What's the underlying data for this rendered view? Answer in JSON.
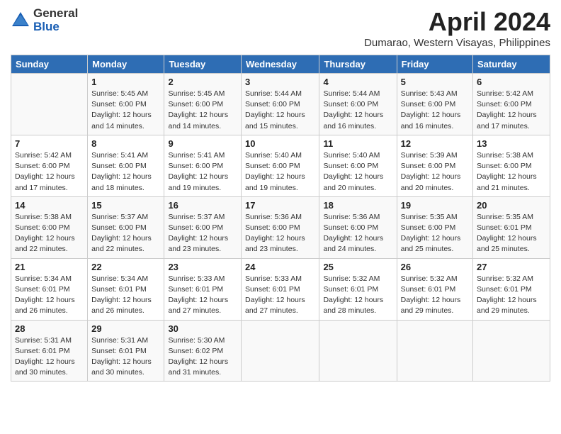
{
  "logo": {
    "general": "General",
    "blue": "Blue"
  },
  "title": "April 2024",
  "subtitle": "Dumarao, Western Visayas, Philippines",
  "days_header": [
    "Sunday",
    "Monday",
    "Tuesday",
    "Wednesday",
    "Thursday",
    "Friday",
    "Saturday"
  ],
  "weeks": [
    [
      {
        "day": "",
        "info": ""
      },
      {
        "day": "1",
        "info": "Sunrise: 5:45 AM\nSunset: 6:00 PM\nDaylight: 12 hours\nand 14 minutes."
      },
      {
        "day": "2",
        "info": "Sunrise: 5:45 AM\nSunset: 6:00 PM\nDaylight: 12 hours\nand 14 minutes."
      },
      {
        "day": "3",
        "info": "Sunrise: 5:44 AM\nSunset: 6:00 PM\nDaylight: 12 hours\nand 15 minutes."
      },
      {
        "day": "4",
        "info": "Sunrise: 5:44 AM\nSunset: 6:00 PM\nDaylight: 12 hours\nand 16 minutes."
      },
      {
        "day": "5",
        "info": "Sunrise: 5:43 AM\nSunset: 6:00 PM\nDaylight: 12 hours\nand 16 minutes."
      },
      {
        "day": "6",
        "info": "Sunrise: 5:42 AM\nSunset: 6:00 PM\nDaylight: 12 hours\nand 17 minutes."
      }
    ],
    [
      {
        "day": "7",
        "info": "Sunrise: 5:42 AM\nSunset: 6:00 PM\nDaylight: 12 hours\nand 17 minutes."
      },
      {
        "day": "8",
        "info": "Sunrise: 5:41 AM\nSunset: 6:00 PM\nDaylight: 12 hours\nand 18 minutes."
      },
      {
        "day": "9",
        "info": "Sunrise: 5:41 AM\nSunset: 6:00 PM\nDaylight: 12 hours\nand 19 minutes."
      },
      {
        "day": "10",
        "info": "Sunrise: 5:40 AM\nSunset: 6:00 PM\nDaylight: 12 hours\nand 19 minutes."
      },
      {
        "day": "11",
        "info": "Sunrise: 5:40 AM\nSunset: 6:00 PM\nDaylight: 12 hours\nand 20 minutes."
      },
      {
        "day": "12",
        "info": "Sunrise: 5:39 AM\nSunset: 6:00 PM\nDaylight: 12 hours\nand 20 minutes."
      },
      {
        "day": "13",
        "info": "Sunrise: 5:38 AM\nSunset: 6:00 PM\nDaylight: 12 hours\nand 21 minutes."
      }
    ],
    [
      {
        "day": "14",
        "info": "Sunrise: 5:38 AM\nSunset: 6:00 PM\nDaylight: 12 hours\nand 22 minutes."
      },
      {
        "day": "15",
        "info": "Sunrise: 5:37 AM\nSunset: 6:00 PM\nDaylight: 12 hours\nand 22 minutes."
      },
      {
        "day": "16",
        "info": "Sunrise: 5:37 AM\nSunset: 6:00 PM\nDaylight: 12 hours\nand 23 minutes."
      },
      {
        "day": "17",
        "info": "Sunrise: 5:36 AM\nSunset: 6:00 PM\nDaylight: 12 hours\nand 23 minutes."
      },
      {
        "day": "18",
        "info": "Sunrise: 5:36 AM\nSunset: 6:00 PM\nDaylight: 12 hours\nand 24 minutes."
      },
      {
        "day": "19",
        "info": "Sunrise: 5:35 AM\nSunset: 6:00 PM\nDaylight: 12 hours\nand 25 minutes."
      },
      {
        "day": "20",
        "info": "Sunrise: 5:35 AM\nSunset: 6:01 PM\nDaylight: 12 hours\nand 25 minutes."
      }
    ],
    [
      {
        "day": "21",
        "info": "Sunrise: 5:34 AM\nSunset: 6:01 PM\nDaylight: 12 hours\nand 26 minutes."
      },
      {
        "day": "22",
        "info": "Sunrise: 5:34 AM\nSunset: 6:01 PM\nDaylight: 12 hours\nand 26 minutes."
      },
      {
        "day": "23",
        "info": "Sunrise: 5:33 AM\nSunset: 6:01 PM\nDaylight: 12 hours\nand 27 minutes."
      },
      {
        "day": "24",
        "info": "Sunrise: 5:33 AM\nSunset: 6:01 PM\nDaylight: 12 hours\nand 27 minutes."
      },
      {
        "day": "25",
        "info": "Sunrise: 5:32 AM\nSunset: 6:01 PM\nDaylight: 12 hours\nand 28 minutes."
      },
      {
        "day": "26",
        "info": "Sunrise: 5:32 AM\nSunset: 6:01 PM\nDaylight: 12 hours\nand 29 minutes."
      },
      {
        "day": "27",
        "info": "Sunrise: 5:32 AM\nSunset: 6:01 PM\nDaylight: 12 hours\nand 29 minutes."
      }
    ],
    [
      {
        "day": "28",
        "info": "Sunrise: 5:31 AM\nSunset: 6:01 PM\nDaylight: 12 hours\nand 30 minutes."
      },
      {
        "day": "29",
        "info": "Sunrise: 5:31 AM\nSunset: 6:01 PM\nDaylight: 12 hours\nand 30 minutes."
      },
      {
        "day": "30",
        "info": "Sunrise: 5:30 AM\nSunset: 6:02 PM\nDaylight: 12 hours\nand 31 minutes."
      },
      {
        "day": "",
        "info": ""
      },
      {
        "day": "",
        "info": ""
      },
      {
        "day": "",
        "info": ""
      },
      {
        "day": "",
        "info": ""
      }
    ]
  ]
}
